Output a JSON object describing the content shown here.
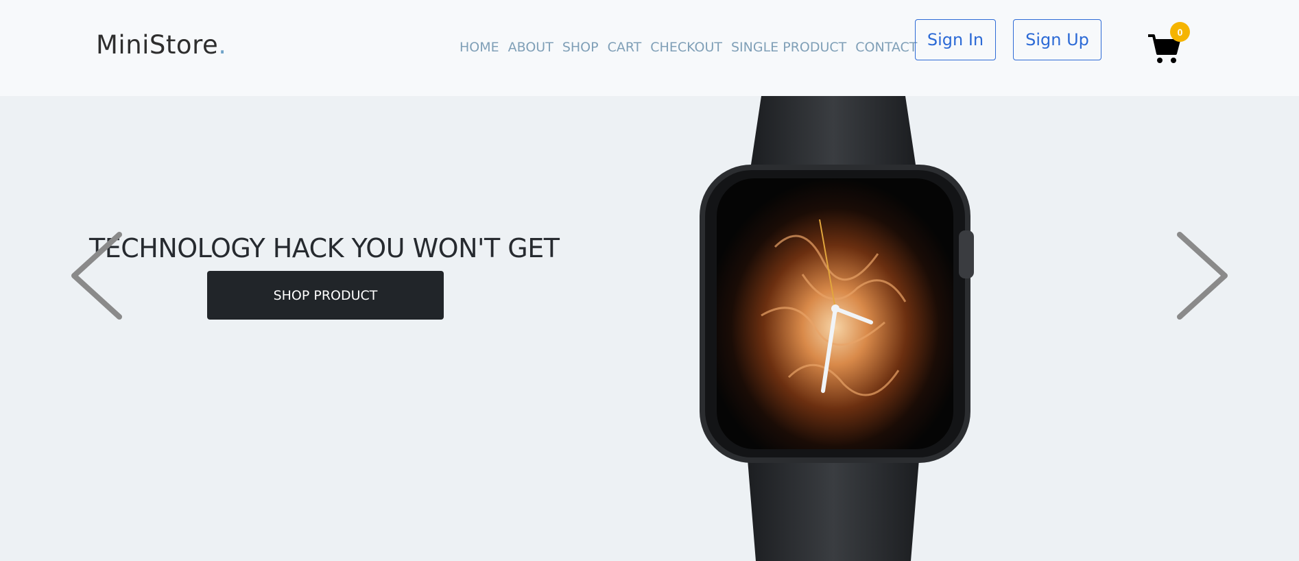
{
  "header": {
    "logo_text": "MiniStore",
    "logo_dot": ".",
    "nav": [
      "HOME",
      "ABOUT",
      "SHOP",
      "CART",
      "CHECKOUT",
      "SINGLE PRODUCT",
      "CONTACT"
    ],
    "sign_in_label": "Sign In",
    "sign_up_label": "Sign Up",
    "cart_icon": "shopping-cart-icon",
    "cart_count": "0"
  },
  "hero": {
    "headline": "TECHNOLOGY HACK YOU WON'T GET",
    "cta_label": "SHOP PRODUCT",
    "image": "smartwatch-image",
    "prev_icon": "chevron-left-icon",
    "next_icon": "chevron-right-icon"
  },
  "colors": {
    "header_bg": "#f7f9fb",
    "hero_bg": "#edf1f4",
    "nav_link": "#7f9fb7",
    "accent_blue": "#2c6ad6",
    "badge": "#f5b400",
    "cta_bg": "#212529"
  }
}
